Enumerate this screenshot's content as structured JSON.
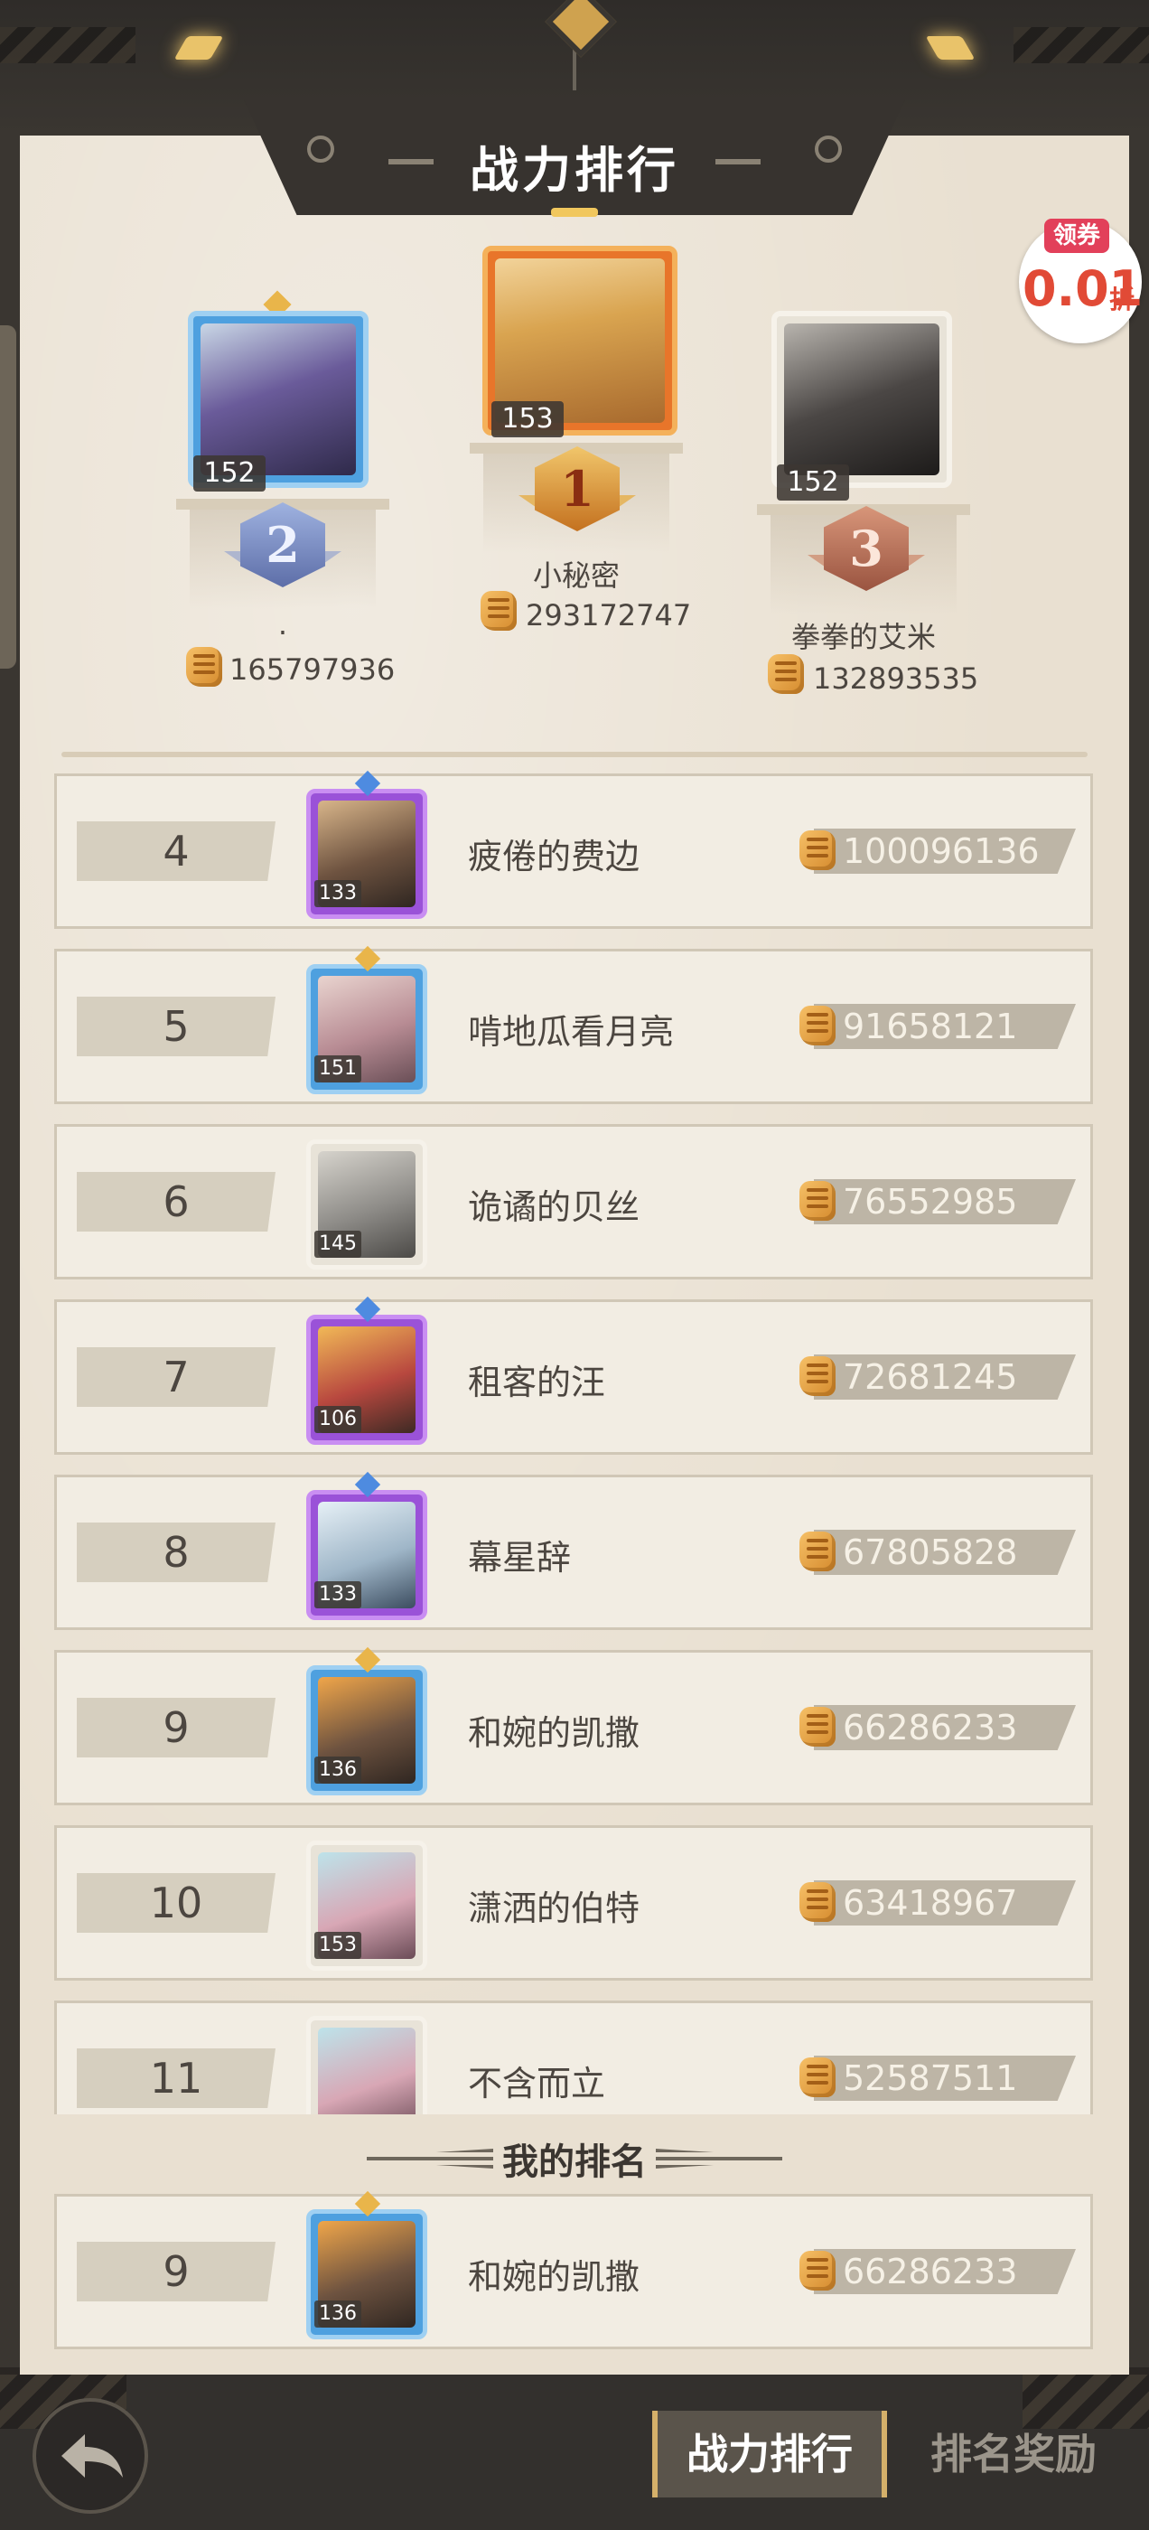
{
  "header": {
    "title": "战力排行"
  },
  "promo": {
    "badge": "领券",
    "value": "0.01",
    "unit": "折"
  },
  "podium": [
    {
      "rank": "2",
      "level": "152",
      "name": ".",
      "power": "165797936"
    },
    {
      "rank": "1",
      "level": "153",
      "name": "小秘密",
      "power": "293172747"
    },
    {
      "rank": "3",
      "level": "152",
      "name": "拳拳的艾米",
      "power": "132893535"
    }
  ],
  "ranking": [
    {
      "rank": "4",
      "level": "133",
      "name": "疲倦的费边",
      "power": "100096136"
    },
    {
      "rank": "5",
      "level": "151",
      "name": "啃地瓜看月亮",
      "power": "91658121"
    },
    {
      "rank": "6",
      "level": "145",
      "name": "诡谲的贝丝",
      "power": "76552985"
    },
    {
      "rank": "7",
      "level": "106",
      "name": "租客的汪",
      "power": "72681245"
    },
    {
      "rank": "8",
      "level": "133",
      "name": "幕星辞",
      "power": "67805828"
    },
    {
      "rank": "9",
      "level": "136",
      "name": "和婉的凯撒",
      "power": "66286233"
    },
    {
      "rank": "10",
      "level": "153",
      "name": "潇洒的伯特",
      "power": "63418967"
    },
    {
      "rank": "11",
      "level": "",
      "name": "不含而立",
      "power": "52587511"
    }
  ],
  "my_rank": {
    "title": "我的排名",
    "rank": "9",
    "level": "136",
    "name": "和婉的凯撒",
    "power": "66286233"
  },
  "tabs": {
    "power": "战力排行",
    "reward": "排名奖励"
  },
  "colors": {
    "panel": "#e9e0d1",
    "frame": "#37332f",
    "text": "#4c4640",
    "gold": "#d5b06a",
    "silver_medal": "#7c8fc4",
    "gold_medal": "#d28a2d",
    "bronze_medal": "#b87059",
    "frame_purple": "#9a52d8",
    "frame_blue": "#4ea0df",
    "frame_plain": "#e8e3d8",
    "frame_orange": "#e8752a"
  },
  "icons": {
    "power": "fist-icon",
    "back": "back-arrow-icon"
  }
}
